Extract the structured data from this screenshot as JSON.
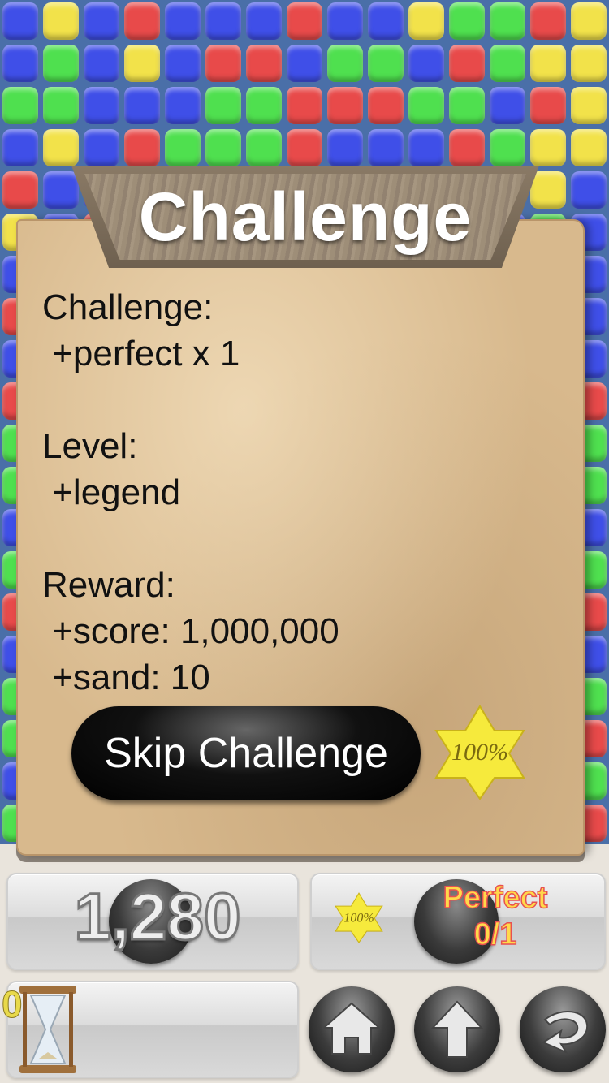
{
  "board": {
    "rows": [
      "bybrbbbrbbyggry",
      "bgbybrrbggbrgyy",
      "ggbbbggrrrggbry",
      "bybrgggrbbbrgyy"
    ]
  },
  "dialog": {
    "title": "Challenge",
    "lines": [
      "Challenge:",
      " +perfect x 1",
      "",
      "Level:",
      " +legend",
      "",
      "Reward:",
      " +score: 1,000,000",
      " +sand: 10"
    ],
    "skip_button_label": "Skip Challenge",
    "perfect_star_text": "100%"
  },
  "hud": {
    "score": "1,280",
    "perfect_star_text": "100%",
    "perfect_label": "Perfect",
    "perfect_count": "0/1",
    "sand_count": "0"
  },
  "icons": {
    "home": "home-icon",
    "up": "arrow-up-icon",
    "back": "back-arrow-icon",
    "hourglass": "hourglass-icon"
  },
  "colors": {
    "red": "#e84a4a",
    "green": "#4fe04f",
    "blue": "#3f4fe8",
    "yellow": "#f2e24a"
  }
}
